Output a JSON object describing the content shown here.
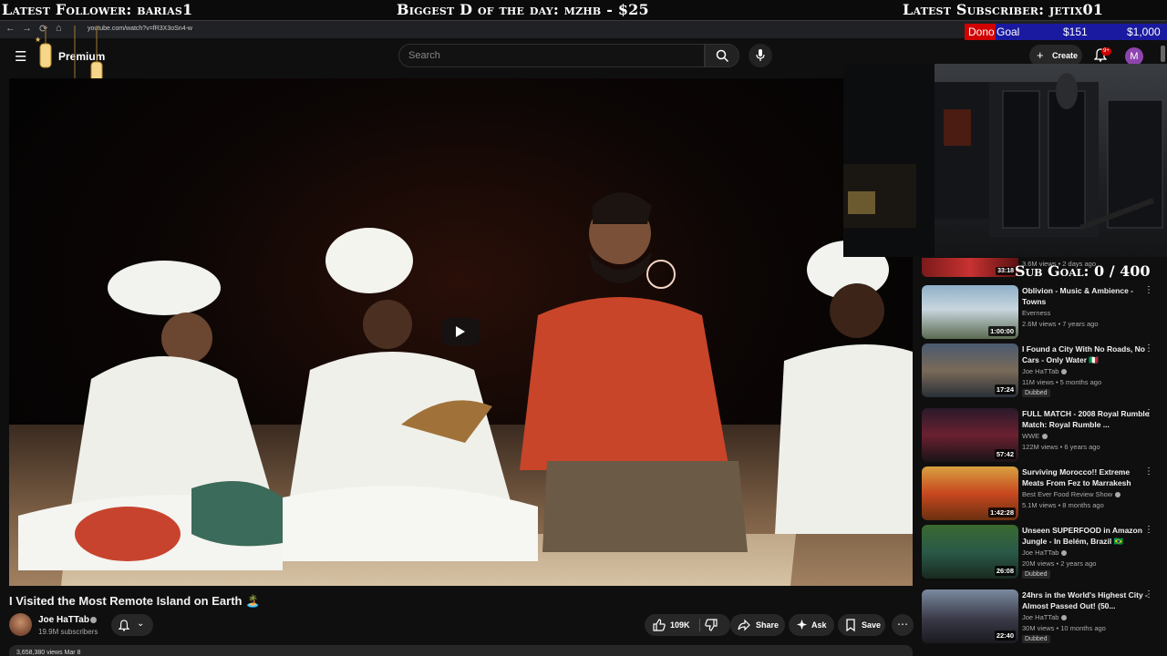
{
  "overlay": {
    "latest_follower": "Latest Follower: barias1",
    "biggest_d": "Biggest D of the day: mzhb - $25",
    "latest_subscriber": "Latest Subscriber: jetix01",
    "dono_goal": {
      "dono": "Dono",
      "goal": "Goal",
      "current": "$151",
      "target": "$1,000"
    },
    "sub_goal": "Sub Goal: 0 / 400"
  },
  "browser": {
    "url": "youtube.com/watch?v=fR3X3oSn4-w"
  },
  "header": {
    "logo": "Premium",
    "search_placeholder": "Search",
    "create_label": "Create",
    "notif_count": "9+",
    "avatar_letter": "M"
  },
  "video": {
    "title": "I Visited the Most Remote Island on Earth 🏝️",
    "channel": "Joe HaTTab",
    "subscribers": "19.9M subscribers",
    "likes": "109K",
    "share": "Share",
    "ask": "Ask",
    "save": "Save",
    "description_peek": "3,658,380 views Mar 8"
  },
  "sidebar": {
    "first_meta": "3.6M views • 2 days ago",
    "first_duration": "33:18",
    "recommendations": [
      {
        "title": "Oblivion - Music & Ambience - Towns",
        "channel": "Everness",
        "meta": "2.6M views • 7 years ago",
        "duration": "1:00:00",
        "verified": false,
        "badge": ""
      },
      {
        "title": "I Found a City With No Roads, No Cars - Only Water 🇮🇹",
        "channel": "Joe HaTTab",
        "meta": "11M views • 5 months ago",
        "duration": "17:24",
        "verified": true,
        "badge": "Dubbed"
      },
      {
        "title": "FULL MATCH - 2008 Royal Rumble Match: Royal Rumble ...",
        "channel": "WWE",
        "meta": "122M views • 6 years ago",
        "duration": "57:42",
        "verified": true,
        "badge": ""
      },
      {
        "title": "Surviving Morocco!! Extreme Meats From Fez to Marrakesh",
        "channel": "Best Ever Food Review Show",
        "meta": "5.1M views • 8 months ago",
        "duration": "1:42:28",
        "verified": true,
        "badge": ""
      },
      {
        "title": "Unseen SUPERFOOD in Amazon Jungle - In Belém, Brazil 🇧🇷",
        "channel": "Joe HaTTab",
        "meta": "20M views • 2 years ago",
        "duration": "26:08",
        "verified": true,
        "badge": "Dubbed"
      },
      {
        "title": "24hrs in the World's Highest City - Almost Passed Out! (50...",
        "channel": "Joe HaTTab",
        "meta": "30M views • 10 months ago",
        "duration": "22:40",
        "verified": true,
        "badge": "Dubbed"
      }
    ]
  }
}
